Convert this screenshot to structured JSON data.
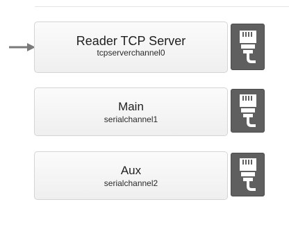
{
  "channels": [
    {
      "name": "Reader TCP Server",
      "id": "tcpserverchannel0",
      "connector_icon": "ethernet-plug-icon",
      "active": true
    },
    {
      "name": "Main",
      "id": "serialchannel1",
      "connector_icon": "ethernet-plug-icon",
      "active": false
    },
    {
      "name": "Aux",
      "id": "serialchannel2",
      "connector_icon": "ethernet-plug-icon",
      "active": false
    }
  ],
  "indicator_icon": "arrow-right-icon",
  "colors": {
    "card_border": "#d4d4d4",
    "card_bg": "#f3f3f3",
    "connector_bg": "#5f5f5f",
    "connector_icon": "#ffffff",
    "arrow": "#7a7a7a"
  }
}
